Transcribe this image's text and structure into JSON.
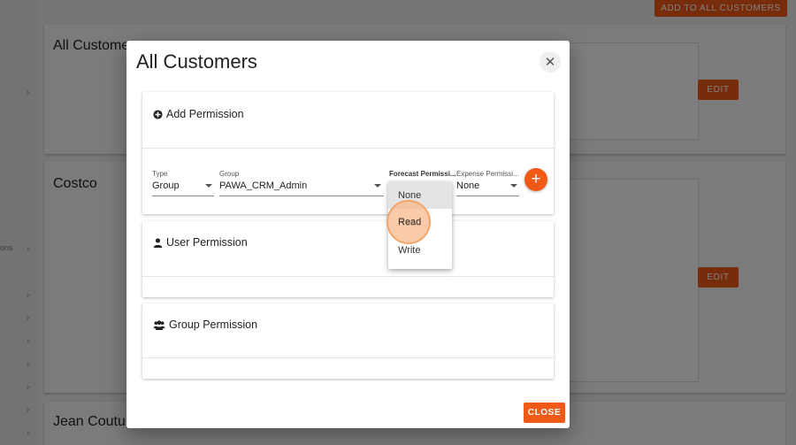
{
  "background": {
    "top_button": "ADD TO ALL CUSTOMERS",
    "sidebar_fragment": "ons",
    "cards": [
      {
        "title": "All Custome",
        "edit": "EDIT"
      },
      {
        "title": "Costco",
        "edit": "EDIT"
      },
      {
        "title": "Jean Coutu"
      }
    ]
  },
  "dialog": {
    "title": "All Customers",
    "close_icon": "close-icon",
    "add_permission": {
      "heading": "Add Permission",
      "icon": "plus-circle-icon",
      "type": {
        "label": "Type",
        "value": "Group"
      },
      "group": {
        "label": "Group",
        "value": "PAWA_CRM_Admin"
      },
      "forecast": {
        "label": "Forecast Permissi...",
        "value": "None"
      },
      "expense": {
        "label": "Expense Permissi...",
        "value": "None"
      },
      "add_button": "+"
    },
    "forecast_options": [
      "None",
      "Read",
      "Write"
    ],
    "user_permission": {
      "heading": "User Permission",
      "icon": "user-icon"
    },
    "group_permission": {
      "heading": "Group Permission",
      "icon": "users-icon"
    },
    "close_button": "CLOSE"
  }
}
